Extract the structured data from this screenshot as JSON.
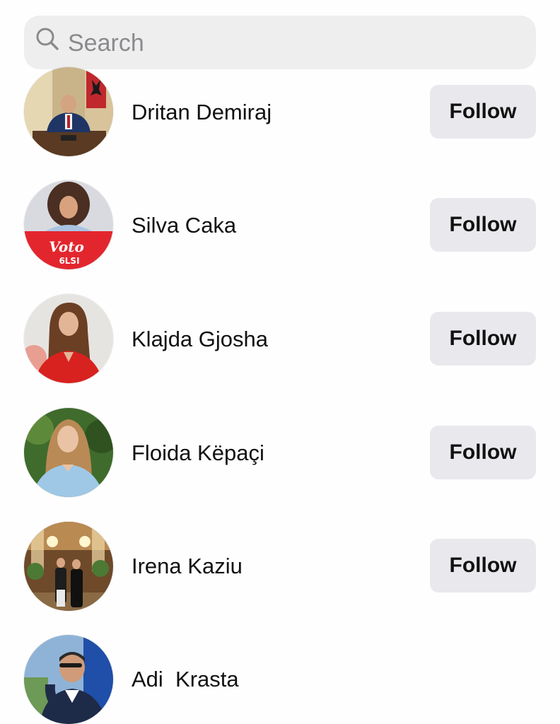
{
  "search": {
    "placeholder": "Search",
    "icon": "search-icon"
  },
  "accounts": [
    {
      "name": "Dritan Demiraj",
      "follow_label": "Follow",
      "avatar": "profile-photo"
    },
    {
      "name": "Silva Caka",
      "follow_label": "Follow",
      "avatar": "profile-photo",
      "avatar_text": "Voto",
      "avatar_badge": "6LSI"
    },
    {
      "name": "Klajda Gjosha",
      "follow_label": "Follow",
      "avatar": "profile-photo"
    },
    {
      "name": "Floida Këpaçi",
      "follow_label": "Follow",
      "avatar": "profile-photo"
    },
    {
      "name": "Irena Kaziu",
      "follow_label": "Follow",
      "avatar": "profile-photo"
    },
    {
      "name": "Adi  Krasta",
      "avatar": "profile-photo"
    }
  ],
  "colors": {
    "search_bg": "#eeeeef",
    "button_bg": "#e9e9ed",
    "text": "#111111",
    "placeholder": "#8a8a8e"
  }
}
